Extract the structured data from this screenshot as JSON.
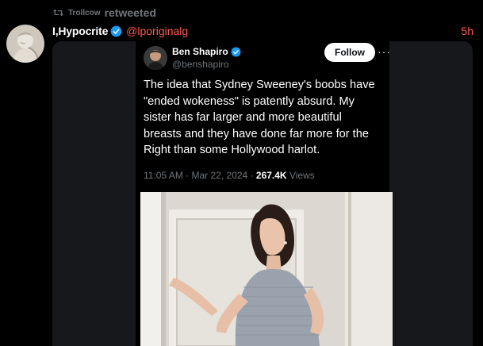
{
  "retweet": {
    "user": "Trollcow",
    "label": "retweeted"
  },
  "post": {
    "display_name": "I,Hypocrite",
    "handle": "@lporiginalg",
    "time": "5h"
  },
  "embedded_tweet": {
    "name": "Ben Shapiro",
    "handle": "@benshapiro",
    "follow_label": "Follow",
    "more_label": "···",
    "text": "The idea that Sydney Sweeney's boobs have \"ended wokeness\" is patently absurd. My sister has far larger and more beautiful breasts and they have done far more for the Right than some Hollywood harlot.",
    "time": "11:05 AM",
    "date": "Mar 22, 2024",
    "views_count": "267.4K",
    "views_label": "Views",
    "separator": "·"
  },
  "colors": {
    "background": "#000000",
    "verified": "#1d9bf0",
    "handle": "#ff5a4f",
    "muted": "#71767b"
  }
}
